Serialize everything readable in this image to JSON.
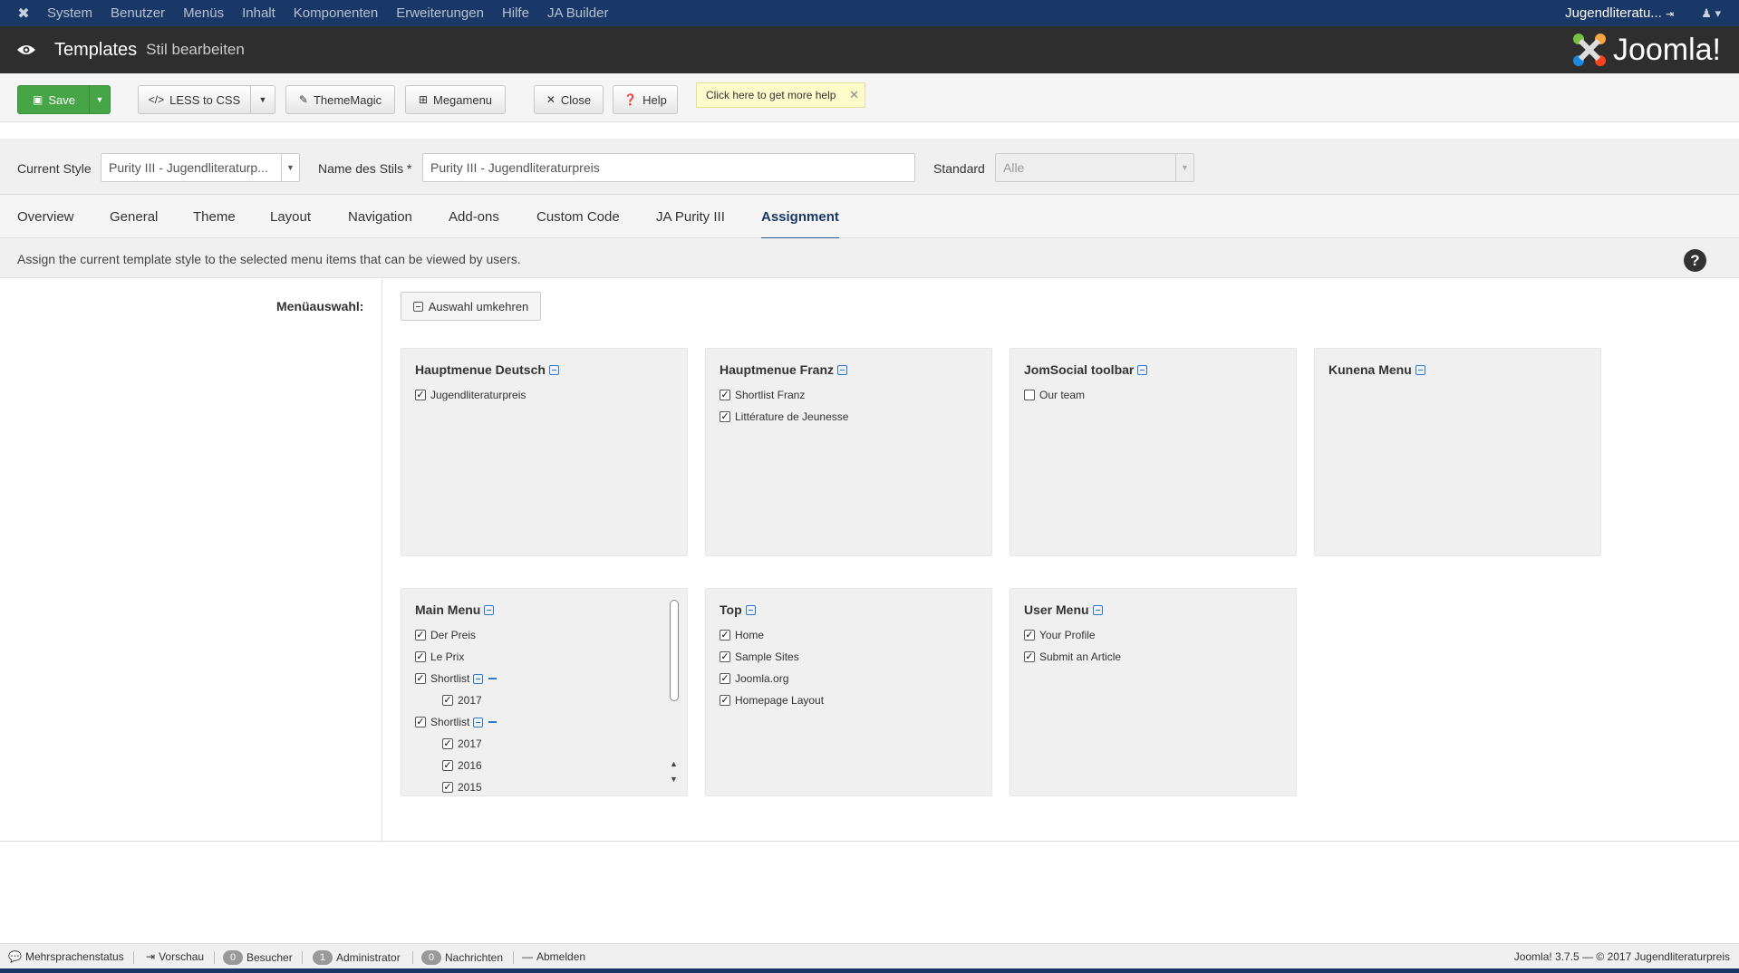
{
  "topnav": {
    "items": [
      "System",
      "Benutzer",
      "Menüs",
      "Inhalt",
      "Komponenten",
      "Erweiterungen",
      "Hilfe",
      "JA Builder"
    ],
    "site_name": "Jugendliteratu...",
    "user_icon": "user-icon"
  },
  "header": {
    "title": "Templates",
    "subtitle": "Stil bearbeiten",
    "logo_text": "Joomla!"
  },
  "toolbar": {
    "save": "Save",
    "less_to_css": "LESS to CSS",
    "thememagic": "ThemeMagic",
    "megamenu": "Megamenu",
    "close": "Close",
    "help": "Help",
    "help_tip": "Click here to get more help"
  },
  "style": {
    "current_style_label": "Current Style",
    "current_style_value": "Purity III - Jugendliteraturp...",
    "name_label": "Name des Stils *",
    "name_value": "Purity III - Jugendliteraturpreis",
    "standard_label": "Standard",
    "standard_value": "Alle"
  },
  "tabs": [
    "Overview",
    "General",
    "Theme",
    "Layout",
    "Navigation",
    "Add-ons",
    "Custom Code",
    "JA Purity III",
    "Assignment"
  ],
  "active_tab": "Assignment",
  "info": {
    "text": "Assign the current template style to the selected menu items that can be viewed by users."
  },
  "assignment": {
    "menu_label": "Menüauswahl:",
    "invert_button": "Auswahl umkehren",
    "menus": [
      {
        "title": "Hauptmenue Deutsch",
        "items": [
          {
            "label": "Jugendliteraturpreis",
            "checked": true
          }
        ]
      },
      {
        "title": "Hauptmenue Franz",
        "items": [
          {
            "label": "Shortlist Franz",
            "checked": true
          },
          {
            "label": "Littérature de Jeunesse",
            "checked": true
          }
        ]
      },
      {
        "title": "JomSocial toolbar",
        "items": [
          {
            "label": "Our team",
            "checked": false
          }
        ]
      },
      {
        "title": "Kunena Menu",
        "items": []
      },
      {
        "title": "Main Menu",
        "items": [
          {
            "label": "Der Preis",
            "checked": true
          },
          {
            "label": "Le Prix",
            "checked": true
          },
          {
            "label": "Shortlist",
            "checked": true
          },
          {
            "label": "2017",
            "checked": true
          },
          {
            "label": "Shortlist",
            "checked": true
          },
          {
            "label": "2017",
            "checked": true
          },
          {
            "label": "2016",
            "checked": true
          },
          {
            "label": "2015",
            "checked": true
          }
        ]
      },
      {
        "title": "Top",
        "items": [
          {
            "label": "Home",
            "checked": true
          },
          {
            "label": "Sample Sites",
            "checked": true
          },
          {
            "label": "Joomla.org",
            "checked": true
          },
          {
            "label": "Homepage Layout",
            "checked": true
          }
        ]
      },
      {
        "title": "User Menu",
        "items": [
          {
            "label": "Your Profile",
            "checked": true
          },
          {
            "label": "Submit an Article",
            "checked": true
          }
        ]
      }
    ]
  },
  "footer": {
    "multilang": "Mehrsprachenstatus",
    "preview": "Vorschau",
    "visitors_count": "0",
    "visitors": "Besucher",
    "admin_count": "1",
    "admin": "Administrator",
    "messages_count": "0",
    "messages": "Nachrichten",
    "logout": "Abmelden",
    "copyright": "Joomla! 3.7.5  —  © 2017 Jugendliteraturpreis"
  },
  "colors": {
    "navbar": "#1a3867",
    "header": "#2e2e2e",
    "save_green": "#46a546",
    "accent_blue": "#2b7bd1"
  }
}
